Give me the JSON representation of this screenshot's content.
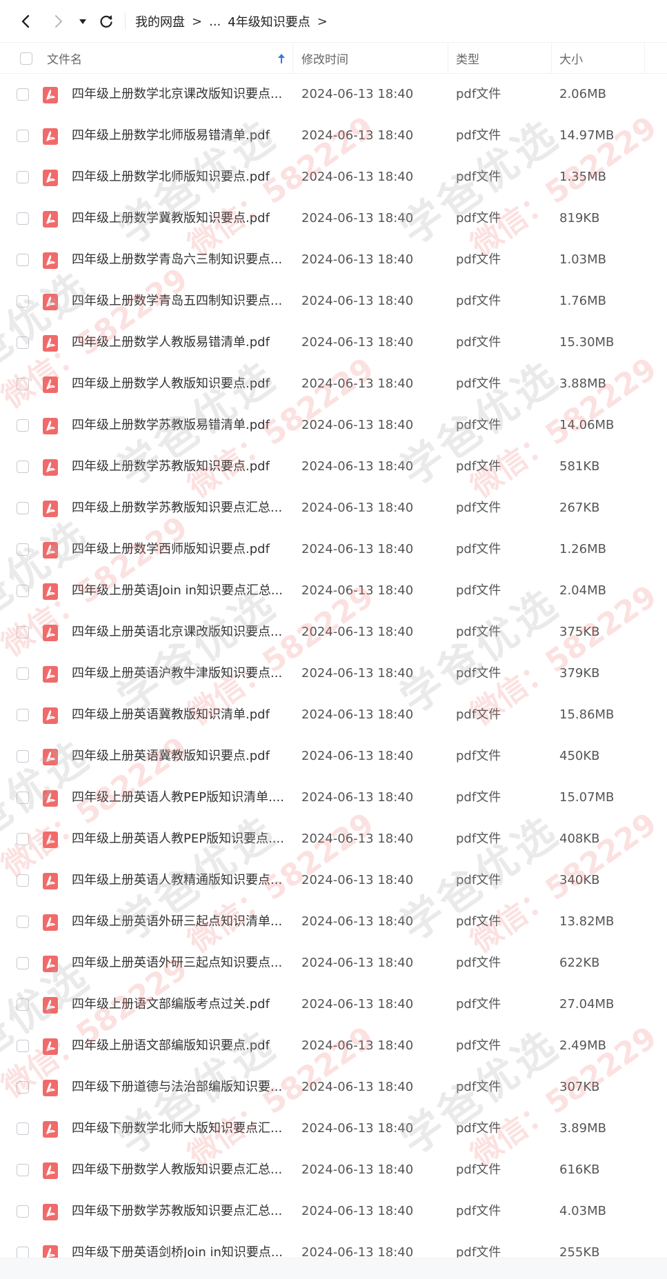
{
  "toolbar": {
    "back_icon": "chevron-left-icon",
    "forward_icon": "chevron-right-icon",
    "dropdown_icon": "caret-down-icon",
    "refresh_icon": "refresh-icon"
  },
  "breadcrumb": {
    "root": "我的网盘",
    "sep1": ">",
    "ellipsis": "...",
    "current": "4年级知识要点",
    "sep2": ">"
  },
  "columns": {
    "name": "文件名",
    "modified": "修改时间",
    "type": "类型",
    "size": "大小",
    "sort_icon": "sort-ascending-arrow-icon"
  },
  "file_icon": "pdf-file-icon",
  "accent_color": "#f16a6a",
  "files": [
    {
      "name": "四年级上册数学北京课改版知识要点....",
      "date": "2024-06-13 18:40",
      "type": "pdf文件",
      "size": "2.06MB"
    },
    {
      "name": "四年级上册数学北师版易错清单.pdf",
      "date": "2024-06-13 18:40",
      "type": "pdf文件",
      "size": "14.97MB"
    },
    {
      "name": "四年级上册数学北师版知识要点.pdf",
      "date": "2024-06-13 18:40",
      "type": "pdf文件",
      "size": "1.35MB"
    },
    {
      "name": "四年级上册数学冀教版知识要点.pdf",
      "date": "2024-06-13 18:40",
      "type": "pdf文件",
      "size": "819KB"
    },
    {
      "name": "四年级上册数学青岛六三制知识要点....",
      "date": "2024-06-13 18:40",
      "type": "pdf文件",
      "size": "1.03MB"
    },
    {
      "name": "四年级上册数学青岛五四制知识要点....",
      "date": "2024-06-13 18:40",
      "type": "pdf文件",
      "size": "1.76MB"
    },
    {
      "name": "四年级上册数学人教版易错清单.pdf",
      "date": "2024-06-13 18:40",
      "type": "pdf文件",
      "size": "15.30MB"
    },
    {
      "name": "四年级上册数学人教版知识要点.pdf",
      "date": "2024-06-13 18:40",
      "type": "pdf文件",
      "size": "3.88MB"
    },
    {
      "name": "四年级上册数学苏教版易错清单.pdf",
      "date": "2024-06-13 18:40",
      "type": "pdf文件",
      "size": "14.06MB"
    },
    {
      "name": "四年级上册数学苏教版知识要点.pdf",
      "date": "2024-06-13 18:40",
      "type": "pdf文件",
      "size": "581KB"
    },
    {
      "name": "四年级上册数学苏教版知识要点汇总....",
      "date": "2024-06-13 18:40",
      "type": "pdf文件",
      "size": "267KB"
    },
    {
      "name": "四年级上册数学西师版知识要点.pdf",
      "date": "2024-06-13 18:40",
      "type": "pdf文件",
      "size": "1.26MB"
    },
    {
      "name": "四年级上册英语Join in知识要点汇总....",
      "date": "2024-06-13 18:40",
      "type": "pdf文件",
      "size": "2.04MB"
    },
    {
      "name": "四年级上册英语北京课改版知识要点....",
      "date": "2024-06-13 18:40",
      "type": "pdf文件",
      "size": "375KB"
    },
    {
      "name": "四年级上册英语沪教牛津版知识要点....",
      "date": "2024-06-13 18:40",
      "type": "pdf文件",
      "size": "379KB"
    },
    {
      "name": "四年级上册英语冀教版知识清单.pdf",
      "date": "2024-06-13 18:40",
      "type": "pdf文件",
      "size": "15.86MB"
    },
    {
      "name": "四年级上册英语冀教版知识要点.pdf",
      "date": "2024-06-13 18:40",
      "type": "pdf文件",
      "size": "450KB"
    },
    {
      "name": "四年级上册英语人教PEP版知识清单....",
      "date": "2024-06-13 18:40",
      "type": "pdf文件",
      "size": "15.07MB"
    },
    {
      "name": "四年级上册英语人教PEP版知识要点....",
      "date": "2024-06-13 18:40",
      "type": "pdf文件",
      "size": "408KB"
    },
    {
      "name": "四年级上册英语人教精通版知识要点....",
      "date": "2024-06-13 18:40",
      "type": "pdf文件",
      "size": "340KB"
    },
    {
      "name": "四年级上册英语外研三起点知识清单....",
      "date": "2024-06-13 18:40",
      "type": "pdf文件",
      "size": "13.82MB"
    },
    {
      "name": "四年级上册英语外研三起点知识要点....",
      "date": "2024-06-13 18:40",
      "type": "pdf文件",
      "size": "622KB"
    },
    {
      "name": "四年级上册语文部编版考点过关.pdf",
      "date": "2024-06-13 18:40",
      "type": "pdf文件",
      "size": "27.04MB"
    },
    {
      "name": "四年级上册语文部编版知识要点.pdf",
      "date": "2024-06-13 18:40",
      "type": "pdf文件",
      "size": "2.49MB"
    },
    {
      "name": "四年级下册道德与法治部编版知识要...",
      "date": "2024-06-13 18:40",
      "type": "pdf文件",
      "size": "307KB"
    },
    {
      "name": "四年级下册数学北师大版知识要点汇...",
      "date": "2024-06-13 18:40",
      "type": "pdf文件",
      "size": "3.89MB"
    },
    {
      "name": "四年级下册数学人教版知识要点汇总....",
      "date": "2024-06-13 18:40",
      "type": "pdf文件",
      "size": "616KB"
    },
    {
      "name": "四年级下册数学苏教版知识要点汇总....",
      "date": "2024-06-13 18:40",
      "type": "pdf文件",
      "size": "4.03MB"
    },
    {
      "name": "四年级下册英语剑桥Join in知识要点...",
      "date": "2024-06-13 18:40",
      "type": "pdf文件",
      "size": "255KB"
    }
  ],
  "watermark": {
    "main": "学爸优选",
    "sub": "微信：582229"
  }
}
